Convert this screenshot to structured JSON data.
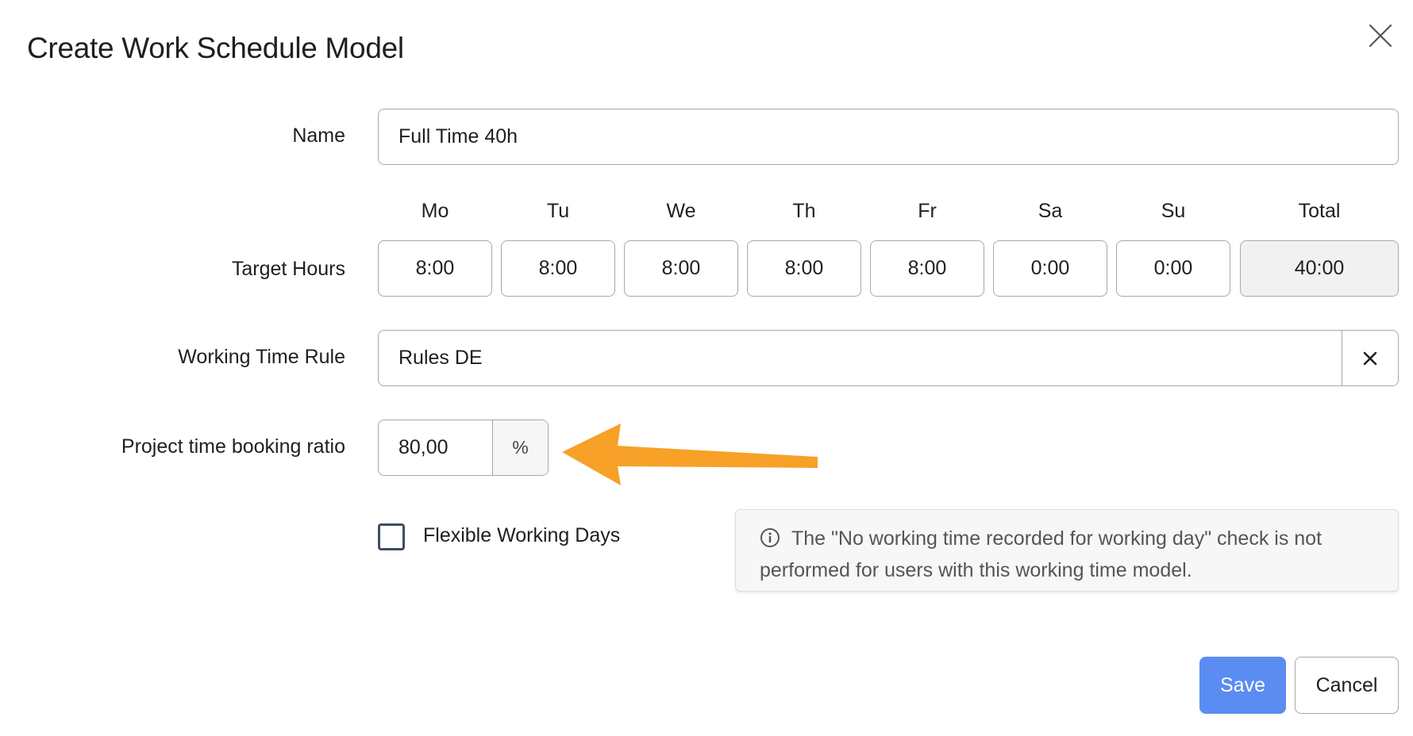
{
  "dialog": {
    "title": "Create Work Schedule Model",
    "close_icon": "close-icon"
  },
  "form": {
    "name_label": "Name",
    "name_value": "Full Time 40h",
    "target_hours_label": "Target Hours",
    "days": [
      {
        "head": "Mo",
        "value": "8:00"
      },
      {
        "head": "Tu",
        "value": "8:00"
      },
      {
        "head": "We",
        "value": "8:00"
      },
      {
        "head": "Th",
        "value": "8:00"
      },
      {
        "head": "Fr",
        "value": "8:00"
      },
      {
        "head": "Sa",
        "value": "0:00"
      },
      {
        "head": "Su",
        "value": "0:00"
      }
    ],
    "total": {
      "head": "Total",
      "value": "40:00"
    },
    "working_time_rule_label": "Working Time Rule",
    "working_time_rule_value": "Rules DE",
    "ratio_label": "Project time booking ratio",
    "ratio_value": "80,00",
    "ratio_unit": "%",
    "flexible_label": "Flexible Working Days",
    "flexible_checked": false,
    "info_text": "The \"No working time recorded for working day\" check is not performed for users with this working time model."
  },
  "buttons": {
    "save": "Save",
    "cancel": "Cancel"
  },
  "colors": {
    "accent": "#5b8cf2",
    "annotation_arrow": "#f7a128"
  }
}
